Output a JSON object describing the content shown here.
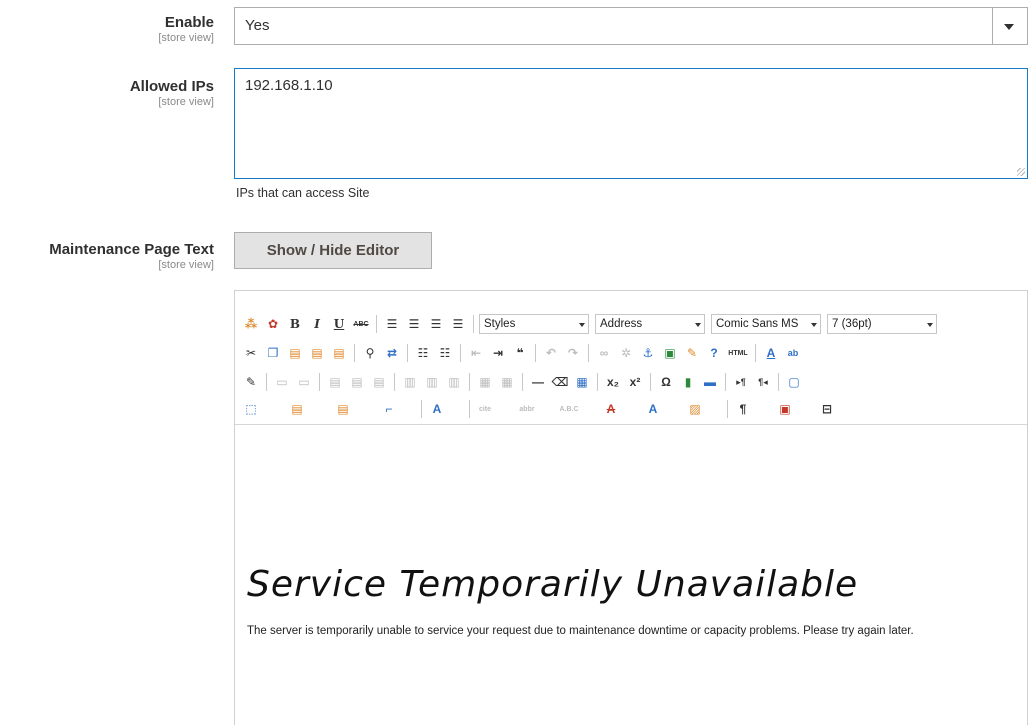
{
  "fields": {
    "enable": {
      "label": "Enable",
      "scope": "[store view]",
      "value": "Yes"
    },
    "allowed_ips": {
      "label": "Allowed IPs",
      "scope": "[store view]",
      "value": "192.168.1.10",
      "note": "IPs that can access Site"
    },
    "maintenance_text": {
      "label": "Maintenance Page Text",
      "scope": "[store view]",
      "toggle_label": "Show / Hide Editor"
    }
  },
  "editor": {
    "toolbar": {
      "styles": "Styles",
      "format": "Address",
      "font_family": "Comic Sans MS",
      "font_size": "7 (36pt)",
      "bold": "B",
      "italic": "I",
      "underline": "U",
      "strike": "ABC",
      "html": "HTML",
      "omega": "Ω",
      "pilcrow": "¶"
    },
    "content": {
      "headline": "Service Temporarily Unavailable",
      "body": "The server is temporarily unable to service your request due to maintenance downtime or capacity problems. Please try again later."
    }
  }
}
